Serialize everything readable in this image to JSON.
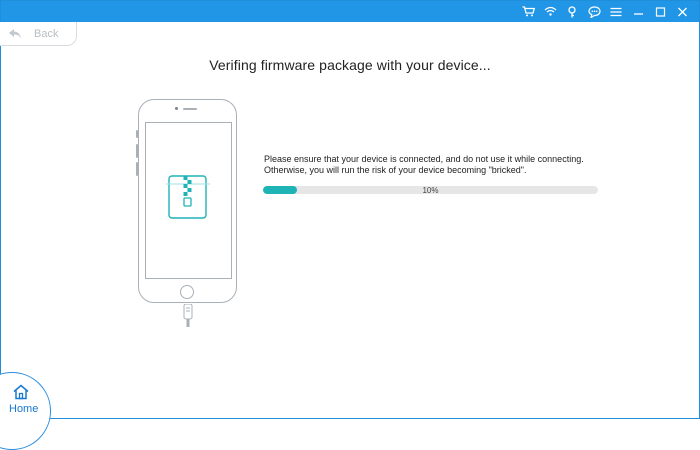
{
  "titlebar": {
    "color": "#2196e6",
    "icons": [
      "cart-icon",
      "key-icon",
      "feedback-icon",
      "menu-icon",
      "minimize-icon",
      "maximize-icon",
      "close-icon"
    ]
  },
  "nav": {
    "back_label": "Back"
  },
  "main": {
    "title": "Verifing firmware package with your device...",
    "message_line1": "Please ensure that your device is connected, and do not use it while connecting.",
    "message_line2": "Otherwise, you will run the risk of your device becoming \"bricked\".",
    "progress_fraction": 0.1,
    "progress_text": "10%",
    "accent_color": "#1eb3b5"
  },
  "footer": {
    "home_label": "Home"
  }
}
